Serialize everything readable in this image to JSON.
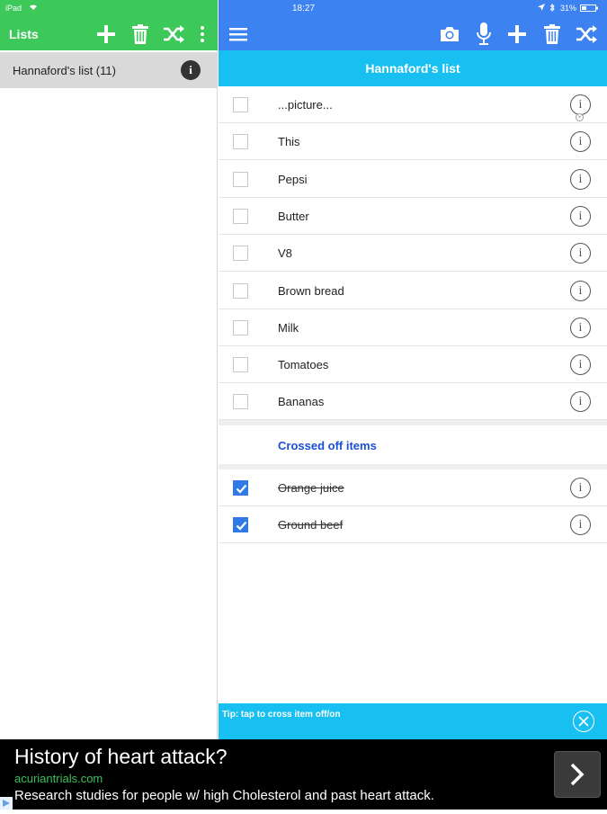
{
  "status_bar": {
    "device": "iPad",
    "time": "18:27",
    "battery": "31%"
  },
  "left_toolbar": {
    "title": "Lists",
    "icons": [
      "plus-icon",
      "trash-icon",
      "shuffle-icon",
      "more-vertical-icon"
    ]
  },
  "lists": [
    {
      "label": "Hannaford's list (11)"
    }
  ],
  "right_toolbar": {
    "icons": [
      "menu-icon",
      "camera-icon",
      "microphone-icon",
      "plus-icon",
      "trash-icon",
      "shuffle-icon"
    ]
  },
  "list_header": {
    "title": "Hannaford's list"
  },
  "items": [
    {
      "label": "...picture...",
      "checked": false
    },
    {
      "label": "This",
      "checked": false
    },
    {
      "label": "Pepsi",
      "checked": false
    },
    {
      "label": "Butter",
      "checked": false
    },
    {
      "label": "V8",
      "checked": false
    },
    {
      "label": "Brown bread",
      "checked": false
    },
    {
      "label": "Milk",
      "checked": false
    },
    {
      "label": "Tomatoes",
      "checked": false
    },
    {
      "label": "Bananas",
      "checked": false
    }
  ],
  "crossed_section": {
    "label": "Crossed off items"
  },
  "crossed_items": [
    {
      "label": "Orange juice",
      "checked": true
    },
    {
      "label": "Ground beef",
      "checked": true
    }
  ],
  "tip": {
    "text": "Tip: tap to cross item off/on"
  },
  "ad": {
    "headline": "History of heart attack?",
    "url": "acuriantrials.com",
    "body": "Research studies for people w/ high Cholesterol and past heart attack."
  },
  "colors": {
    "left_bar": "#3dc85a",
    "right_bar": "#3c82f0",
    "header": "#17c0f0",
    "section_label": "#1a4fd6",
    "check": "#2f7ae5"
  }
}
